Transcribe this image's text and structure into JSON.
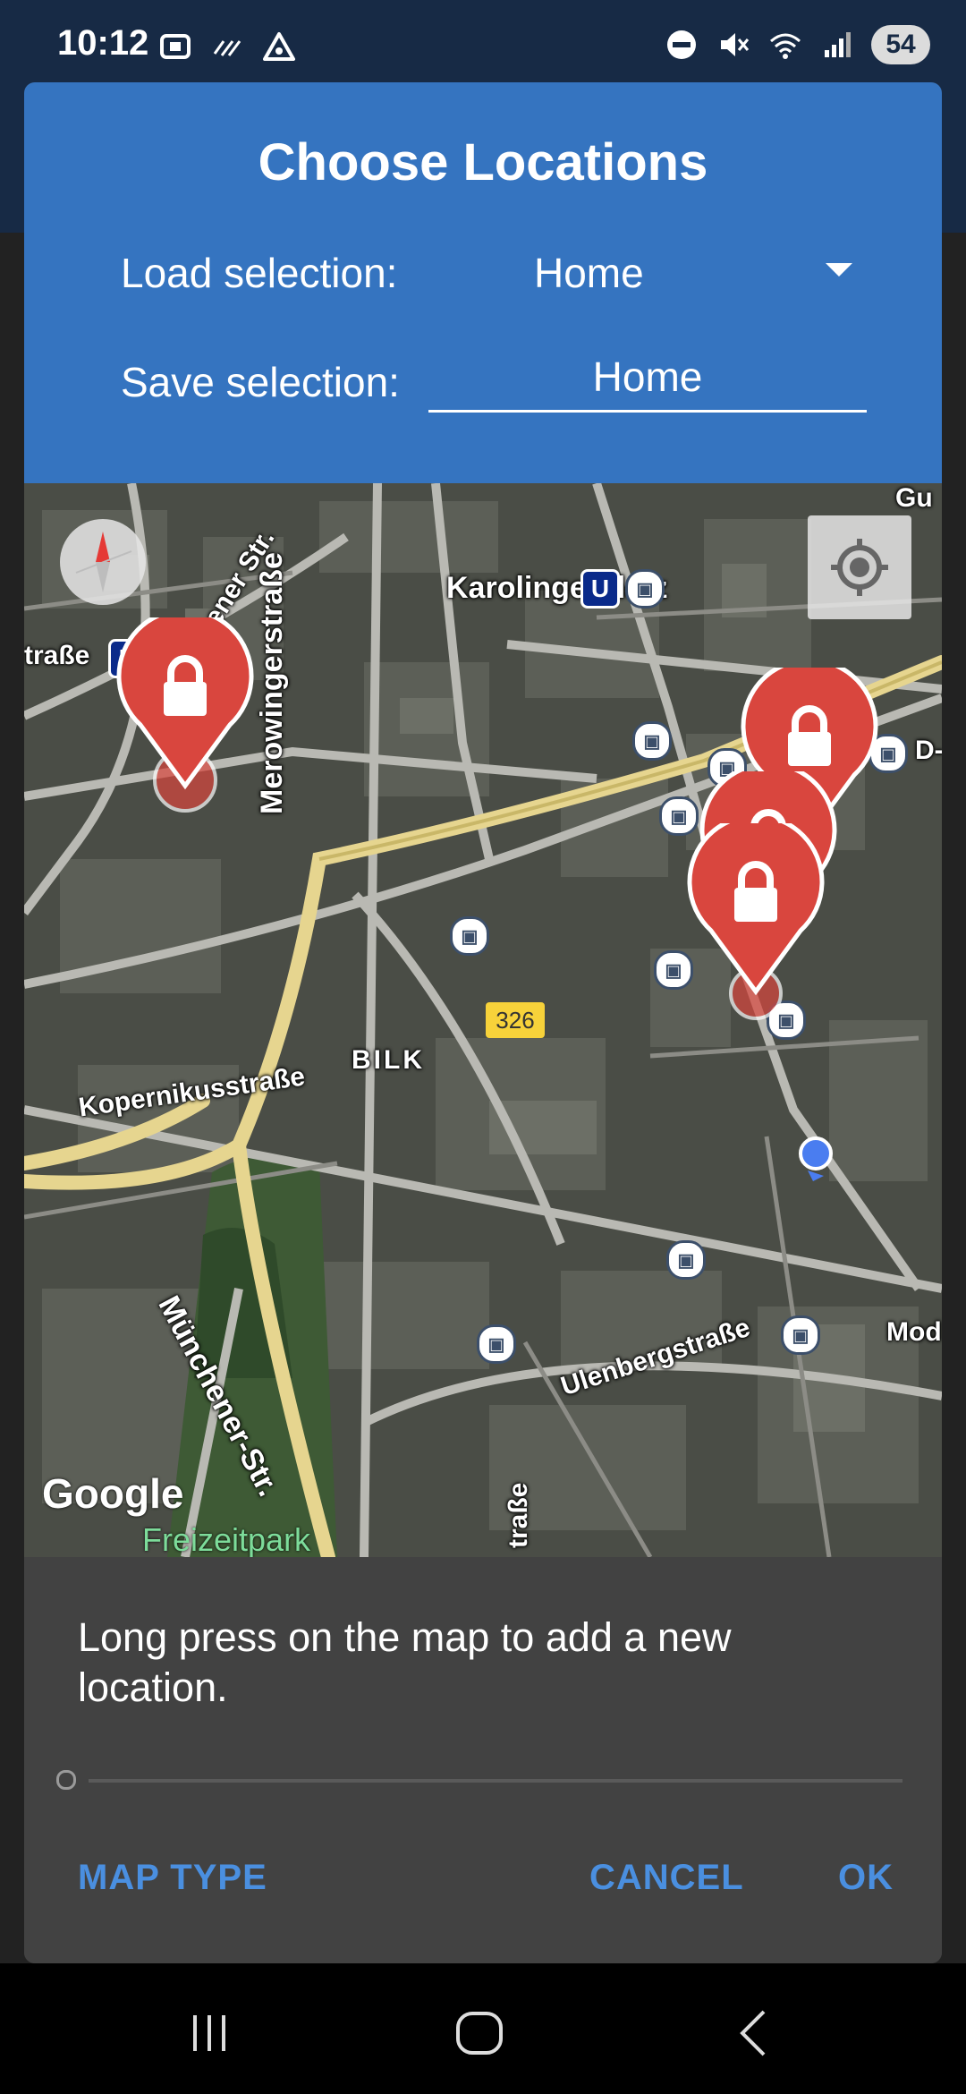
{
  "status_bar": {
    "time": "10:12",
    "battery": "54",
    "left_icons": [
      "screenshot-icon",
      "signal-pattern-icon",
      "warning-triangle-icon"
    ],
    "right_icons": [
      "do-not-disturb-icon",
      "mute-icon",
      "wifi-icon",
      "cell-signal-icon"
    ]
  },
  "dialog": {
    "title": "Choose Locations",
    "load_label": "Load selection:",
    "load_value": "Home",
    "save_label": "Save selection:",
    "save_value": "Home",
    "hint": "Long press on the map to add a new location.",
    "buttons": {
      "map_type": "MAP TYPE",
      "cancel": "CANCEL",
      "ok": "OK"
    },
    "accent_color": "#3574c0",
    "button_color": "#4a8fe0"
  },
  "map": {
    "labels": {
      "karolingerplatz": "Karolingerplatz",
      "aachener": "Aachener Str.",
      "merowinger": "Merowingerstraße",
      "kopernikus": "Kopernikusstraße",
      "bilk": "BILK",
      "muenchener": "Münchener-Str.",
      "ulenberg": "Ulenbergstraße",
      "strasse_left": "traße",
      "strasse_bottom": "traße",
      "mod": "Mod",
      "d_partial": "D-",
      "gu_partial": "Gu",
      "freizeitpark": "Freizeitpark",
      "google": "Google",
      "road_number": "326"
    },
    "markers": [
      "lock-marker",
      "lock-marker",
      "lock-marker",
      "lock-marker"
    ],
    "marker_color": "#d9463e"
  },
  "nav_bar": {
    "buttons": [
      "recents-icon",
      "home-icon",
      "back-icon"
    ]
  }
}
